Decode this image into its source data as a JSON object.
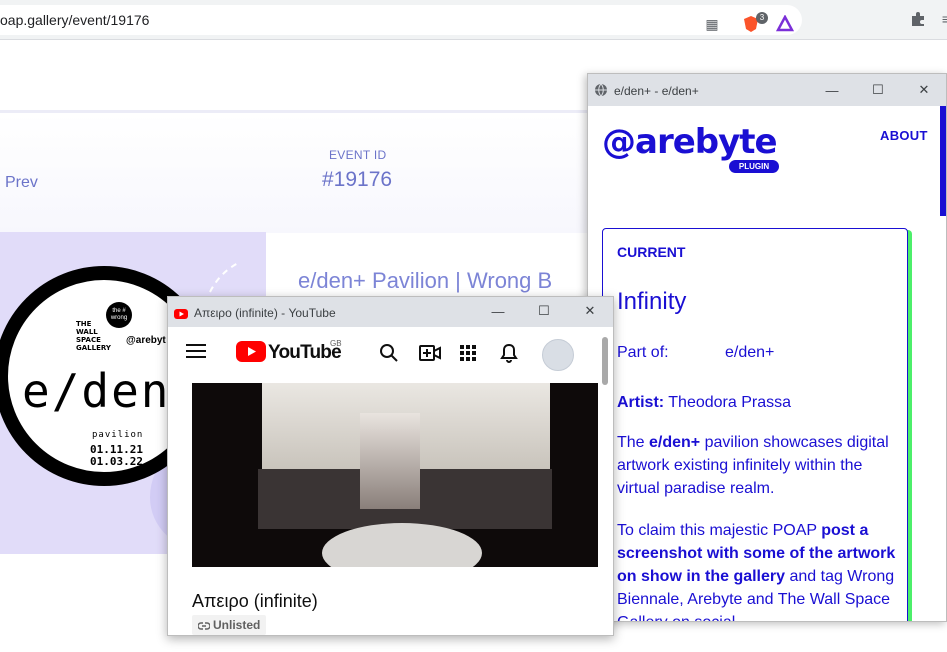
{
  "browser": {
    "url": "oap.gallery/event/19176",
    "brave_badge_count": "3"
  },
  "event_page": {
    "prev_label": "Prev",
    "event_id_label": "EVENT ID",
    "event_id_value": "#19176",
    "event_title": "e/den+ Pavilion | Wrong B",
    "badge": {
      "gallery_line1": "THE",
      "gallery_line2": "WALL",
      "gallery_line3": "SPACE",
      "gallery_line4": "GALLERY",
      "wrong_label": "the # wrong",
      "arebyte_label": "@arebyt",
      "eden": "e/den",
      "pavilion": "pavilion",
      "date1": "01.11.21",
      "date2": "01.03.22"
    }
  },
  "arebyte_popup": {
    "window_title": "e/den+ - e/den+",
    "logo_text": "@arebyte",
    "plugin_label": "PLUGIN",
    "about_label": "ABOUT",
    "card": {
      "current_label": "CURRENT",
      "title": "Infinity",
      "part_of_label": "Part of:",
      "part_of_value": "e/den+",
      "artist_label": "Artist:",
      "artist_name": "Theodora Prassa",
      "desc_prefix": "The ",
      "desc_bold": "e/den+",
      "desc_rest": " pavilion showcases digital artwork existing infinitely within the virtual paradise realm.",
      "claim_prefix": "To claim this majestic POAP ",
      "claim_bold": "post a screenshot with some of the artwork on show in the gallery",
      "claim_rest": " and tag Wrong Biennale, Arebyte and The Wall Space Gallery on social"
    },
    "accent_color": "#1a0fd3",
    "card_shadow_color": "#4cef6a"
  },
  "youtube_popup": {
    "window_title": "Απειρο (infinite) - YouTube",
    "brand": "YouTube",
    "region": "GB",
    "video_title": "Απειρο (infinite)",
    "visibility": "Unlisted",
    "brand_color": "#ff0000"
  }
}
